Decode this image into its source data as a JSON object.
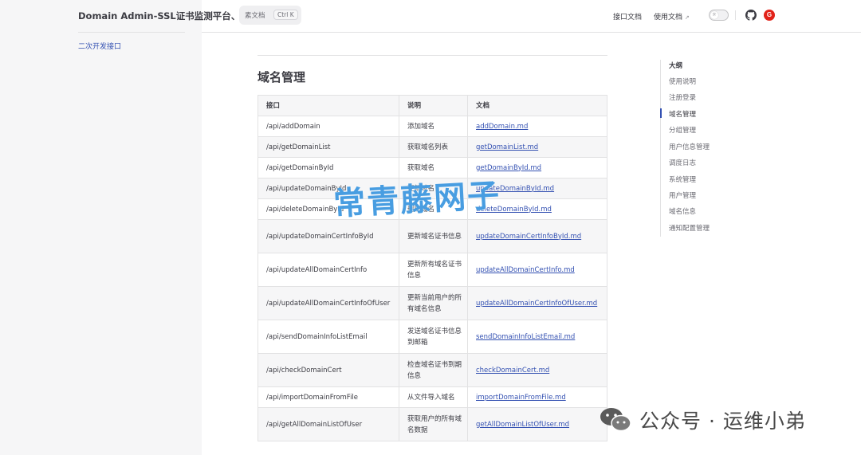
{
  "header": {
    "site_title": "Domain Admin-SSL证书监测平台、到期提醒",
    "search_text": "素文档",
    "search_key": "Ctrl K",
    "nav": [
      {
        "label": "接口文档"
      },
      {
        "label": "使用文档",
        "ext": "↗"
      }
    ]
  },
  "sidebar": {
    "link": "二次开发接口"
  },
  "main": {
    "heading": "域名管理",
    "table": {
      "headers": [
        "接口",
        "说明",
        "文档"
      ],
      "rows": [
        {
          "api": "/api/addDomain",
          "desc": "添加域名",
          "doc": "addDomain.md"
        },
        {
          "api": "/api/getDomainList",
          "desc": "获取域名列表",
          "doc": "getDomainList.md"
        },
        {
          "api": "/api/getDomainById",
          "desc": "获取域名",
          "doc": "getDomainById.md"
        },
        {
          "api": "/api/updateDomainById",
          "desc": "更新域名",
          "doc": "updateDomainById.md"
        },
        {
          "api": "/api/deleteDomainById",
          "desc": "删除域名",
          "doc": "deleteDomainById.md"
        },
        {
          "api": "/api/updateDomainCertInfoById",
          "desc": "更新域名证书信息",
          "doc": "updateDomainCertInfoById.md"
        },
        {
          "api": "/api/updateAllDomainCertInfo",
          "desc": "更新所有域名证书信息",
          "doc": "updateAllDomainCertInfo.md"
        },
        {
          "api": "/api/updateAllDomainCertInfoOfUser",
          "desc": "更新当前用户的所有域名信息",
          "doc": "updateAllDomainCertInfoOfUser.md"
        },
        {
          "api": "/api/sendDomainInfoListEmail",
          "desc": "发送域名证书信息到邮箱",
          "doc": "sendDomainInfoListEmail.md"
        },
        {
          "api": "/api/checkDomainCert",
          "desc": "检查域名证书到期信息",
          "doc": "checkDomainCert.md"
        },
        {
          "api": "/api/importDomainFromFile",
          "desc": "从文件导入域名",
          "doc": "importDomainFromFile.md"
        },
        {
          "api": "/api/getAllDomainListOfUser",
          "desc": "获取用户的所有域名数据",
          "doc": "getAllDomainListOfUser.md"
        }
      ]
    }
  },
  "outline": {
    "title": "大纲",
    "items": [
      "使用说明",
      "注册登录",
      "域名管理",
      "分组管理",
      "用户信息管理",
      "调度日志",
      "系统管理",
      "用户管理",
      "域名信息",
      "通知配置管理"
    ],
    "active_index": 2
  },
  "watermarks": {
    "overlay": "常青藤网子",
    "wechat": "公众号 · 运维小弟"
  },
  "colors": {
    "link": "#3451b2",
    "sidebar_bg": "#f6f6f7",
    "border": "#e2e2e3",
    "brand_icon": "#e2231a"
  }
}
